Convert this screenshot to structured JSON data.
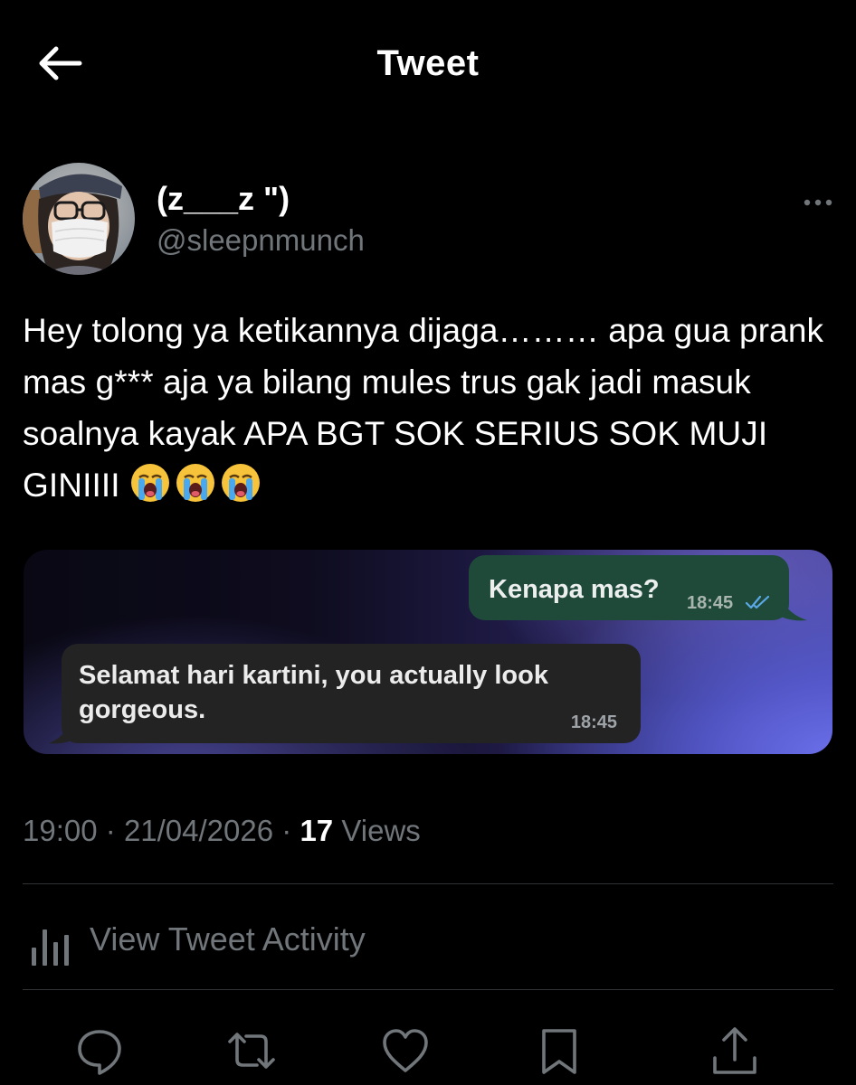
{
  "header": {
    "title": "Tweet",
    "back_icon": "arrow-left-icon"
  },
  "author": {
    "display_name": "(z___z \")",
    "handle": "@sleepnmunch",
    "more_icon": "more-horizontal-icon"
  },
  "tweet": {
    "text": "Hey tolong ya ketikannya dijaga……… apa gua prank mas g*** aja ya bilang mules trus gak jadi masuk soalnya kayak APA BGT SOK SERIUS SOK MUJI GINIIII",
    "emoji": "😭😭😭"
  },
  "media": {
    "outgoing": {
      "text": "Kenapa mas?",
      "time": "18:45",
      "status_icon": "double-check-icon"
    },
    "incoming": {
      "text": "Selamat hari kartini, you actually look gorgeous.",
      "time": "18:45"
    }
  },
  "meta": {
    "time": "19:00",
    "separator": "·",
    "date": "21/04/2026",
    "views_count": "17",
    "views_label": "Views"
  },
  "activity": {
    "label": "View Tweet Activity",
    "icon": "bar-chart-icon"
  },
  "actions": [
    "reply-icon",
    "retweet-icon",
    "like-icon",
    "bookmark-icon",
    "share-icon"
  ],
  "colors": {
    "background": "#000000",
    "secondary_text": "#71767b",
    "outgoing_bubble": "#1f4a3a",
    "incoming_bubble": "#232323",
    "divider": "#2f3336"
  }
}
